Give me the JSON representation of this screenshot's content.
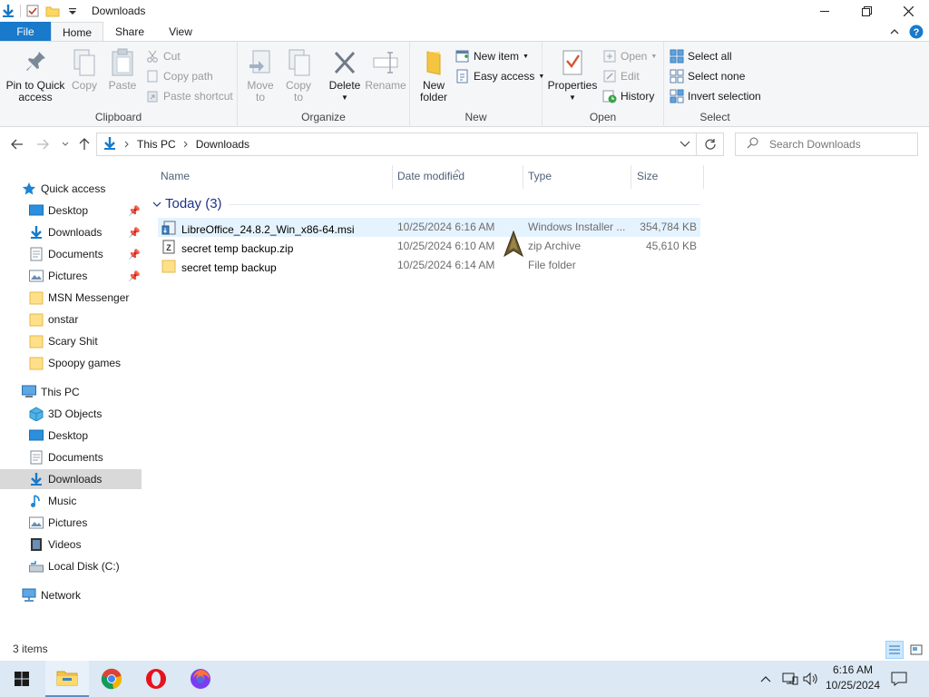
{
  "window": {
    "title": "Downloads"
  },
  "ribbon_tabs": {
    "file": "File",
    "home": "Home",
    "share": "Share",
    "view": "View"
  },
  "clipboard": {
    "pin_line1": "Pin to Quick",
    "pin_line2": "access",
    "copy": "Copy",
    "paste": "Paste",
    "cut": "Cut",
    "copy_path": "Copy path",
    "paste_shortcut": "Paste shortcut",
    "label": "Clipboard"
  },
  "organize": {
    "move_to_1": "Move",
    "move_to_2": "to",
    "copy_to_1": "Copy",
    "copy_to_2": "to",
    "delete": "Delete",
    "rename": "Rename",
    "label": "Organize"
  },
  "new_group": {
    "new_folder_1": "New",
    "new_folder_2": "folder",
    "new_item": "New item",
    "easy_access": "Easy access",
    "label": "New"
  },
  "open_group": {
    "properties": "Properties",
    "open": "Open",
    "edit": "Edit",
    "history": "History",
    "label": "Open"
  },
  "select_group": {
    "select_all": "Select all",
    "select_none": "Select none",
    "invert": "Invert selection",
    "label": "Select"
  },
  "address": {
    "this_pc": "This PC",
    "downloads": "Downloads"
  },
  "search": {
    "placeholder": "Search Downloads"
  },
  "navpane": {
    "quick_access": "Quick access",
    "qa_items": [
      "Desktop",
      "Downloads",
      "Documents",
      "Pictures",
      "MSN Messenger",
      "onstar",
      "Scary Shit",
      "Spoopy games"
    ],
    "this_pc": "This PC",
    "pc_items": [
      "3D Objects",
      "Desktop",
      "Documents",
      "Downloads",
      "Music",
      "Pictures",
      "Videos",
      "Local Disk (C:)"
    ],
    "network": "Network"
  },
  "columns": {
    "name": "Name",
    "date": "Date modified",
    "type": "Type",
    "size": "Size"
  },
  "group": {
    "label": "Today (3)"
  },
  "files": [
    {
      "name": "LibreOffice_24.8.2_Win_x86-64.msi",
      "date": "10/25/2024 6:16 AM",
      "type": "Windows Installer ...",
      "size": "354,784 KB",
      "icon": "msi-installer-icon"
    },
    {
      "name": "secret temp backup.zip",
      "date": "10/25/2024 6:10 AM",
      "type": "zip Archive",
      "size": "45,610 KB",
      "icon": "zip-archive-icon"
    },
    {
      "name": "secret temp backup",
      "date": "10/25/2024 6:14 AM",
      "type": "File folder",
      "size": "",
      "icon": "folder-icon"
    }
  ],
  "status": {
    "items": "3 items"
  },
  "taskbar": {
    "time": "6:16 AM",
    "date": "10/25/2024"
  },
  "colors": {
    "file_tab": "#1979ca",
    "selection": "#e5f3ff",
    "nav_selected": "#d9d9d9",
    "group_header": "#1e3287",
    "taskbar": "#dce8f4"
  }
}
